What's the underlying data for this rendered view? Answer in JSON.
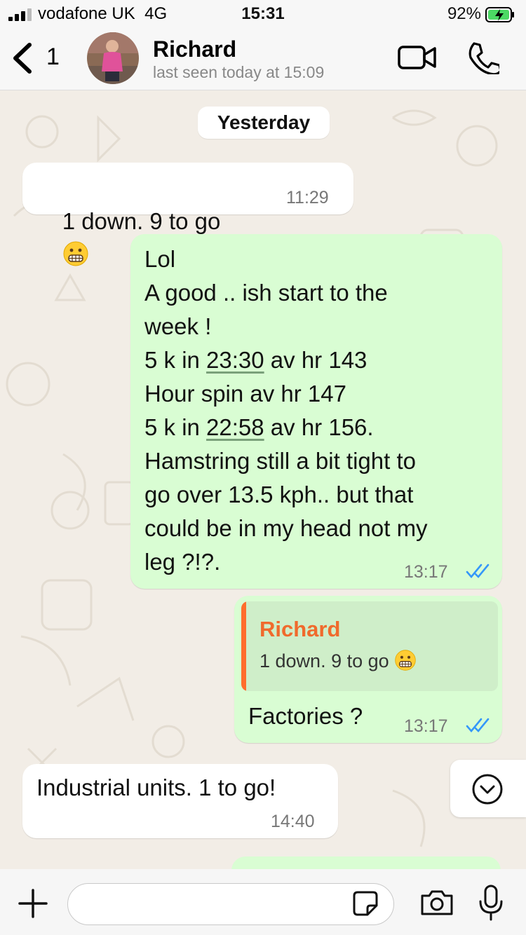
{
  "status_bar": {
    "carrier": "vodafone UK",
    "network": "4G",
    "time": "15:31",
    "battery": "92%"
  },
  "header": {
    "back_count": "1",
    "name": "Richard",
    "status": "last seen today at 15:09"
  },
  "date_chip": "Yesterday",
  "messages": [
    {
      "id": "m1",
      "direction": "incoming",
      "text": "1 down. 9 to go",
      "emoji": "grimacing-face",
      "time": "11:29"
    },
    {
      "id": "m2",
      "direction": "outgoing",
      "lines": [
        "Lol",
        "A good .. ish start to the",
        "week !",
        "5 k in ",
        "23:30",
        " av hr 143",
        "Hour spin av hr 147",
        "5 k in ",
        "22:58",
        " av hr 156.",
        "Hamstring still a bit tight to",
        "go over 13.5 kph.. but that",
        "could be in my head not my",
        "leg ?!?."
      ],
      "time": "13:17",
      "read": true
    },
    {
      "id": "m3",
      "direction": "outgoing",
      "quote": {
        "author": "Richard",
        "text": "1 down. 9 to go",
        "emoji": "grimacing-face"
      },
      "text": "Factories ?",
      "time": "13:17",
      "read": true
    },
    {
      "id": "m4",
      "direction": "incoming",
      "text": "Industrial units. 1 to go!",
      "time": "14:40"
    }
  ],
  "colors": {
    "outgoing": "#d9fdd3",
    "incoming": "#ffffff",
    "quote_name": "#f06a2c",
    "ticks": "#3497f9"
  },
  "icons": [
    "signal-icon",
    "battery-charging-icon",
    "back-chevron-icon",
    "video-call-icon",
    "phone-icon",
    "scroll-down-icon",
    "plus-icon",
    "sticker-icon",
    "camera-icon",
    "microphone-icon"
  ]
}
